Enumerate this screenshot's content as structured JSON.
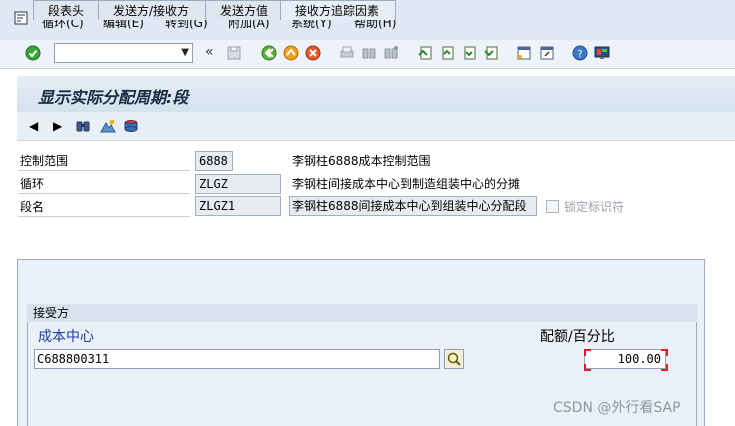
{
  "menu": {
    "items": [
      {
        "id": "cycle",
        "label": "循环(C)"
      },
      {
        "id": "edit",
        "label": "编辑(E)"
      },
      {
        "id": "goto",
        "label": "转到(G)"
      },
      {
        "id": "extras",
        "label": "附加(A)"
      },
      {
        "id": "system",
        "label": "系统(Y)"
      },
      {
        "id": "help",
        "label": "帮助(H)"
      }
    ]
  },
  "toolbar": {
    "command_field_value": "",
    "collapse_label": "«"
  },
  "screen": {
    "title": "显示实际分配周期:段"
  },
  "header_fields": {
    "controlling_area": {
      "label": "控制范围",
      "value": "6888",
      "description": "李钢柱6888成本控制范围"
    },
    "cycle": {
      "label": "循环",
      "value": "ZLGZ",
      "description": "李钢柱间接成本中心到制造组装中心的分摊"
    },
    "segment": {
      "label": "段名",
      "value": "ZLGZ1",
      "description": "李钢柱6888间接成本中心到组装中心分配段"
    },
    "lock_indicator_label": "锁定标识符"
  },
  "tabs": [
    {
      "label": "段表头",
      "active": false
    },
    {
      "label": "发送方/接收方",
      "active": false
    },
    {
      "label": "发送方值",
      "active": false
    },
    {
      "label": "接收方追踪因素",
      "active": true
    }
  ],
  "receivers": {
    "group_title": "接受方",
    "cost_center_header": "成本中心",
    "percentage_header": "配额/百分比",
    "rows": [
      {
        "cost_center": "C688800311",
        "percentage": "100.00"
      }
    ]
  },
  "colors": {
    "menubar_bg": "#dfe9f5",
    "panel_bg": "#eaf0f7",
    "cost_center_header": "#1f3f9c",
    "required_marker": "#dd2222"
  },
  "watermark": "CSDN @外行看SAP"
}
